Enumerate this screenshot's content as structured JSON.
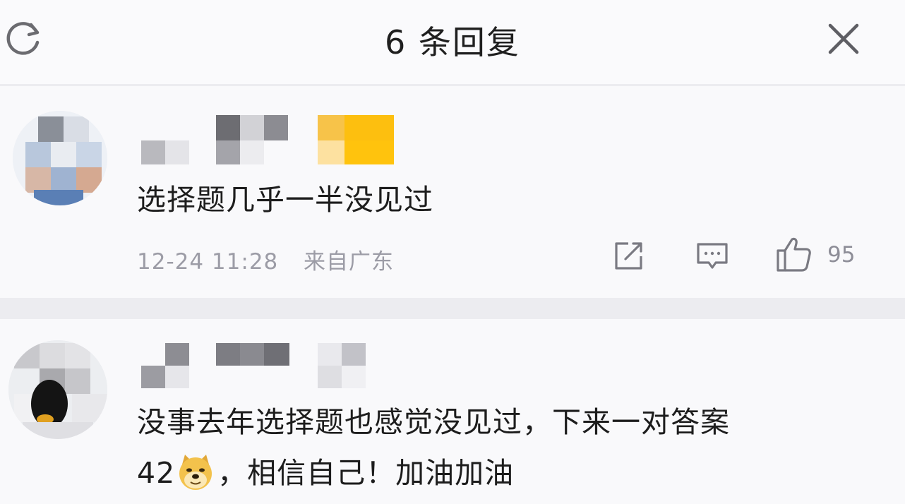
{
  "header": {
    "title": "6 条回复",
    "refresh_icon": "refresh-icon",
    "close_icon": "close-icon"
  },
  "comments": [
    {
      "text": "选择题几乎一半没见过",
      "timestamp": "12-24 11:28",
      "location": "来自广东",
      "like_count": "95",
      "icons": [
        "share-icon",
        "comment-icon",
        "thumbs-up-icon"
      ]
    },
    {
      "text_line1": "没事去年选择题也感觉没见过，下来一对答案",
      "text_line2_before": "42",
      "text_line2_after": "，相信自己！加油加油",
      "emoji": "doge-emoji-icon"
    }
  ],
  "colors": {
    "background": "#f9f9fb",
    "divider": "#ececf0",
    "text": "#1d1d1d",
    "meta_text": "#9c9ca6",
    "badge": "#ffc107"
  }
}
